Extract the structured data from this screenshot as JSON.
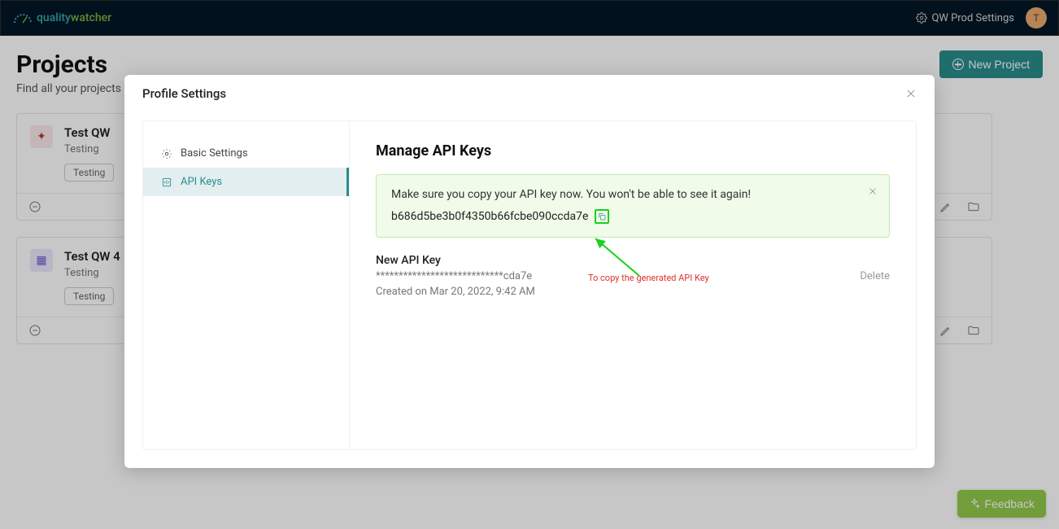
{
  "header": {
    "brand_left": "quality",
    "brand_right": "watcher",
    "settings_label": "QW Prod Settings",
    "avatar_initial": "T"
  },
  "page": {
    "title": "Projects",
    "subtitle": "Find all your projects",
    "new_project": "New Project"
  },
  "projects": [
    {
      "name": "Test QW",
      "sub": "Testing",
      "tag": "Testing"
    },
    {
      "name": "Test QW 4",
      "sub": "Testing",
      "tag": "Testing"
    }
  ],
  "modal": {
    "title": "Profile Settings",
    "nav": {
      "basic": "Basic Settings",
      "api": "API Keys"
    },
    "content": {
      "heading": "Manage API Keys",
      "alert_msg": "Make sure you copy your API key now. You won't be able to see it again!",
      "alert_key": "b686d5be3b0f4350b66fcbe090ccda7e",
      "key_name": "New API Key",
      "key_masked": "****************************cda7e",
      "key_date": "Created on Mar 20, 2022, 9:42 AM",
      "delete": "Delete"
    }
  },
  "annotation": "To copy the generated API Key",
  "feedback": "Feedback"
}
